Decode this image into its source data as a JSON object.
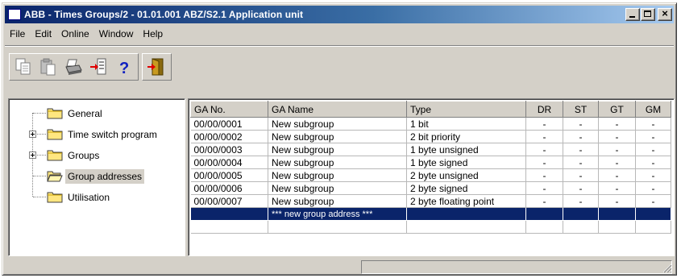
{
  "window": {
    "title": "ABB - Times Groups/2 - 01.01.001 ABZ/S2.1 Application unit"
  },
  "menu": [
    "File",
    "Edit",
    "Online",
    "Window",
    "Help"
  ],
  "toolbar": {
    "groups": [
      [
        "copy-icon",
        "paste-icon",
        "print-icon",
        "import-icon",
        "help-icon"
      ],
      [
        "exit-icon"
      ]
    ]
  },
  "tree": {
    "items": [
      {
        "label": "General",
        "expandable": false,
        "selected": false
      },
      {
        "label": "Time switch program",
        "expandable": true,
        "selected": false
      },
      {
        "label": "Groups",
        "expandable": true,
        "selected": false
      },
      {
        "label": "Group addresses",
        "expandable": false,
        "selected": true
      },
      {
        "label": "Utilisation",
        "expandable": false,
        "selected": false
      }
    ]
  },
  "grid": {
    "columns": [
      "GA No.",
      "GA Name",
      "Type",
      "DR",
      "ST",
      "GT",
      "GM"
    ],
    "rows": [
      [
        "00/00/0001",
        "New subgroup",
        "1 bit",
        "-",
        "-",
        "-",
        "-"
      ],
      [
        "00/00/0002",
        "New subgroup",
        "2 bit priority",
        "-",
        "-",
        "-",
        "-"
      ],
      [
        "00/00/0003",
        "New subgroup",
        "1 byte unsigned",
        "-",
        "-",
        "-",
        "-"
      ],
      [
        "00/00/0004",
        "New subgroup",
        "1 byte signed",
        "-",
        "-",
        "-",
        "-"
      ],
      [
        "00/00/0005",
        "New subgroup",
        "2 byte unsigned",
        "-",
        "-",
        "-",
        "-"
      ],
      [
        "00/00/0006",
        "New subgroup",
        "2 byte signed",
        "-",
        "-",
        "-",
        "-"
      ],
      [
        "00/00/0007",
        "New subgroup",
        "2 byte floating point",
        "-",
        "-",
        "-",
        "-"
      ]
    ],
    "new_row_label": "*** new group address ***"
  },
  "colors": {
    "title_start": "#0a246a",
    "title_end": "#a6caf0",
    "selection": "#0a246a",
    "face": "#d4d0c8"
  }
}
